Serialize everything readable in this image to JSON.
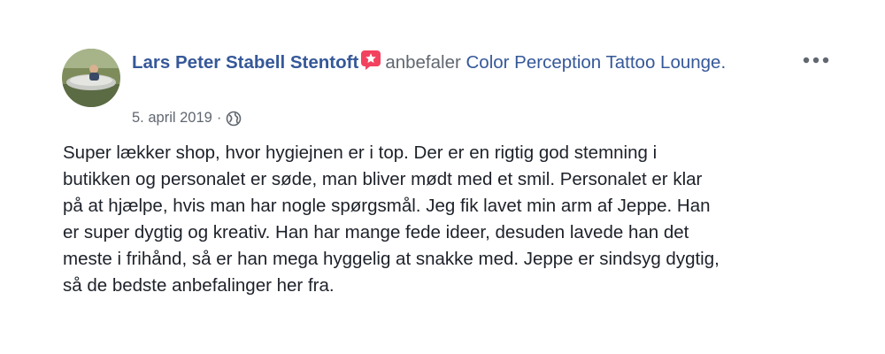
{
  "post": {
    "author": "Lars Peter Stabell Stentoft",
    "badge_icon": "recommendation-star-badge",
    "verb": "anbefaler",
    "page_name": "Color Perception Tattoo Lounge.",
    "date": "5. april 2019",
    "separator": "·",
    "privacy_icon": "globe-icon",
    "more_icon": "more-options-icon",
    "body_lines": [
      "Super lækker shop, hvor hygiejnen er i top. Der er en rigtig god stemning i",
      "butikken og personalet er søde, man bliver mødt med et smil. Personalet er klar",
      "på at hjælpe, hvis man har nogle spørgsmål. Jeg fik lavet min arm af Jeppe. Han",
      "er super dygtig og kreativ. Han har mange fede ideer, desuden lavede han det",
      "meste i frihånd, så er han mega hyggelig at snakke med. Jeppe er sindsyg dygtig,",
      "så de bedste anbefalinger her fra."
    ]
  },
  "colors": {
    "link": "#365899",
    "meta": "#616770",
    "text": "#1d2129",
    "badge": "#f3425f"
  }
}
